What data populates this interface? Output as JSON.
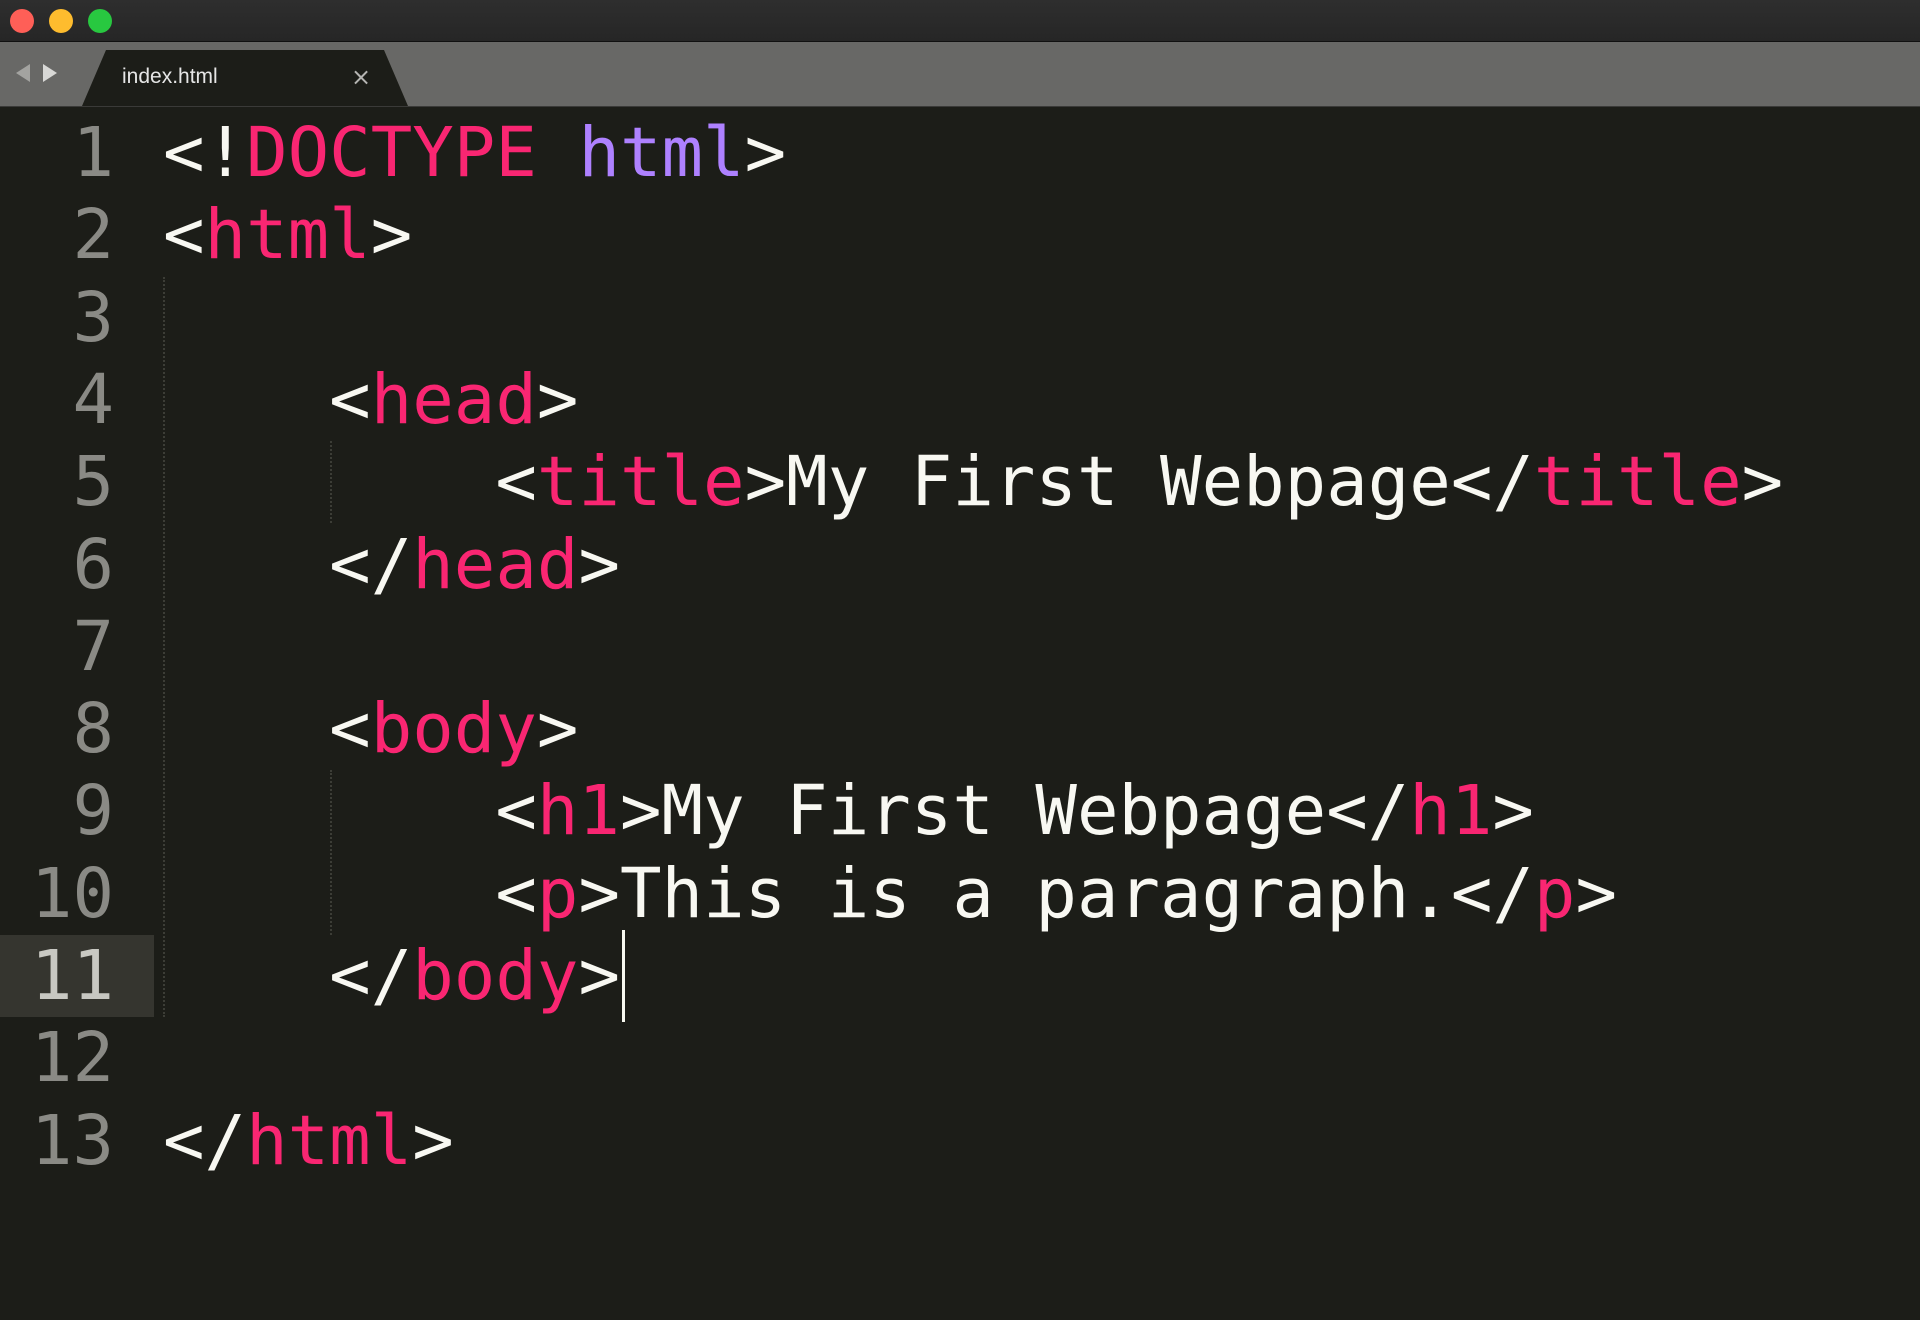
{
  "window": {
    "traffic_colors": {
      "close": "#ff5f57",
      "minimize": "#febc2e",
      "maximize": "#28c840"
    }
  },
  "tabs": [
    {
      "label": "index.html",
      "close_glyph": "×",
      "active": true
    }
  ],
  "editor": {
    "current_line": 11,
    "lines": [
      {
        "num": "1",
        "indent": "",
        "tokens": [
          {
            "t": "<!",
            "c": "punc"
          },
          {
            "t": "DOCTYPE",
            "c": "kw"
          },
          {
            "t": " ",
            "c": "text"
          },
          {
            "t": "html",
            "c": "attr"
          },
          {
            "t": ">",
            "c": "punc"
          }
        ]
      },
      {
        "num": "2",
        "indent": "",
        "tokens": [
          {
            "t": "<",
            "c": "punc"
          },
          {
            "t": "html",
            "c": "tag"
          },
          {
            "t": ">",
            "c": "punc"
          }
        ]
      },
      {
        "num": "3",
        "indent": "",
        "tokens": []
      },
      {
        "num": "4",
        "indent": "    ",
        "tokens": [
          {
            "t": "<",
            "c": "punc"
          },
          {
            "t": "head",
            "c": "tag"
          },
          {
            "t": ">",
            "c": "punc"
          }
        ]
      },
      {
        "num": "5",
        "indent": "        ",
        "tokens": [
          {
            "t": "<",
            "c": "punc"
          },
          {
            "t": "title",
            "c": "tag"
          },
          {
            "t": ">",
            "c": "punc"
          },
          {
            "t": "My First Webpage",
            "c": "text"
          },
          {
            "t": "</",
            "c": "punc"
          },
          {
            "t": "title",
            "c": "tag"
          },
          {
            "t": ">",
            "c": "punc"
          }
        ]
      },
      {
        "num": "6",
        "indent": "    ",
        "tokens": [
          {
            "t": "</",
            "c": "punc"
          },
          {
            "t": "head",
            "c": "tag"
          },
          {
            "t": ">",
            "c": "punc"
          }
        ]
      },
      {
        "num": "7",
        "indent": "",
        "tokens": []
      },
      {
        "num": "8",
        "indent": "    ",
        "tokens": [
          {
            "t": "<",
            "c": "punc"
          },
          {
            "t": "body",
            "c": "tag"
          },
          {
            "t": ">",
            "c": "punc"
          }
        ]
      },
      {
        "num": "9",
        "indent": "        ",
        "tokens": [
          {
            "t": "<",
            "c": "punc"
          },
          {
            "t": "h1",
            "c": "tag"
          },
          {
            "t": ">",
            "c": "punc"
          },
          {
            "t": "My First Webpage",
            "c": "text"
          },
          {
            "t": "</",
            "c": "punc"
          },
          {
            "t": "h1",
            "c": "tag"
          },
          {
            "t": ">",
            "c": "punc"
          }
        ]
      },
      {
        "num": "10",
        "indent": "        ",
        "tokens": [
          {
            "t": "<",
            "c": "punc"
          },
          {
            "t": "p",
            "c": "tag"
          },
          {
            "t": ">",
            "c": "punc"
          },
          {
            "t": "This is a paragraph.",
            "c": "text"
          },
          {
            "t": "</",
            "c": "punc"
          },
          {
            "t": "p",
            "c": "tag"
          },
          {
            "t": ">",
            "c": "punc"
          }
        ]
      },
      {
        "num": "11",
        "indent": "    ",
        "tokens": [
          {
            "t": "</",
            "c": "punc"
          },
          {
            "t": "body",
            "c": "tag"
          },
          {
            "t": ">",
            "c": "punc"
          }
        ]
      },
      {
        "num": "12",
        "indent": "",
        "tokens": []
      },
      {
        "num": "13",
        "indent": "",
        "tokens": [
          {
            "t": "</",
            "c": "punc"
          },
          {
            "t": "html",
            "c": "tag"
          },
          {
            "t": ">",
            "c": "punc"
          }
        ]
      }
    ]
  }
}
